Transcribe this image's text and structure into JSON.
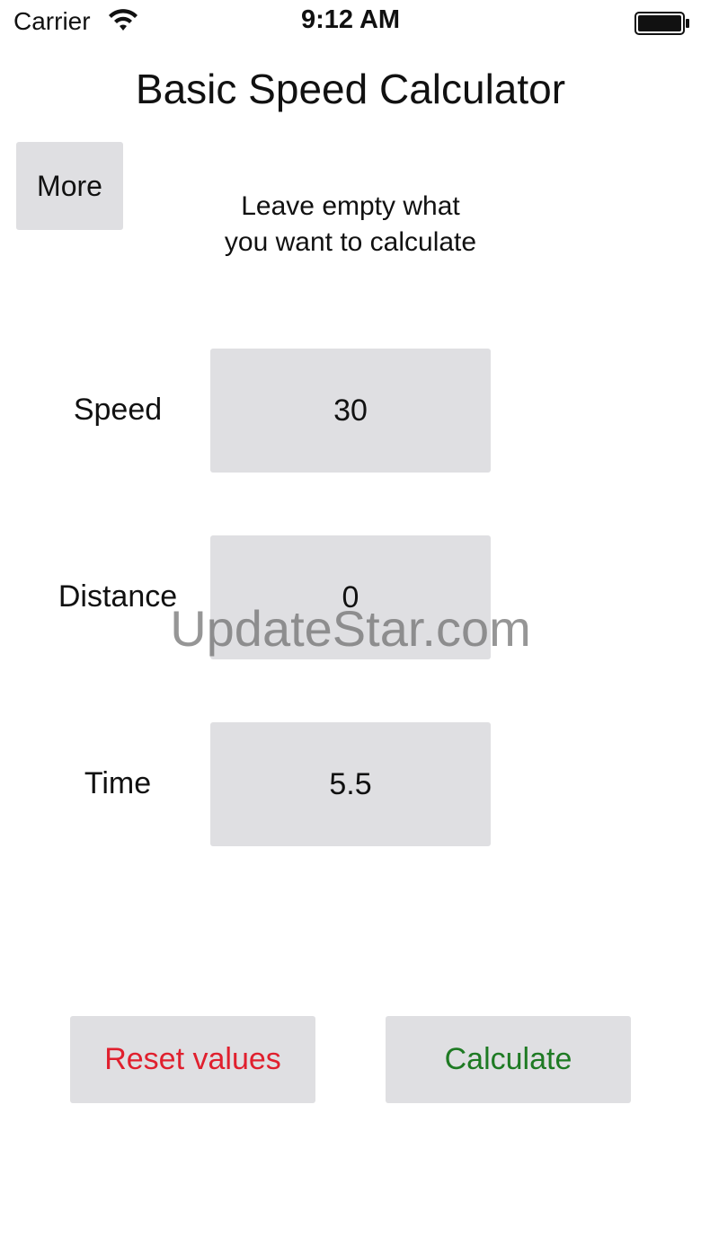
{
  "status_bar": {
    "carrier": "Carrier",
    "time": "9:12 AM",
    "wifi_icon": "wifi-icon",
    "battery_icon": "battery-icon"
  },
  "app": {
    "title": "Basic Speed Calculator",
    "more_label": "More",
    "hint_line1": "Leave empty what",
    "hint_line2": "you want to calculate"
  },
  "fields": {
    "speed": {
      "label": "Speed",
      "value": "30"
    },
    "distance": {
      "label": "Distance",
      "value": "0"
    },
    "time": {
      "label": "Time",
      "value": "5.5"
    }
  },
  "actions": {
    "reset_label": "Reset values",
    "calculate_label": "Calculate"
  },
  "watermark": "UpdateStar.com",
  "colors": {
    "button_bg": "#dfdfe2",
    "reset_text": "#e0202e",
    "calculate_text": "#1e7a23"
  }
}
